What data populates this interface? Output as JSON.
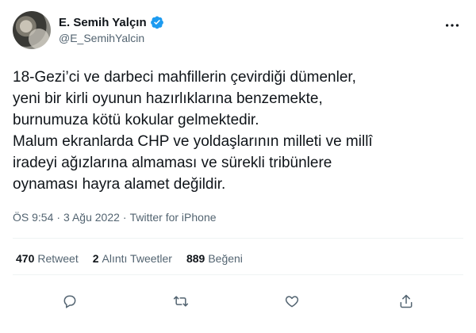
{
  "user": {
    "display_name": "E. Semih Yalçın",
    "handle": "@E_SemihYalcin",
    "verified": true
  },
  "tweet": {
    "text": "18-Gezi’ci ve darbeci mahfillerin çevirdiği dümenler,\nyeni bir kirli oyunun hazırlıklarına benzemekte,\nburnumuza kötü kokular gelmektedir.\nMalum ekranlarda CHP ve yoldaşlarının milleti ve millî\niradeyi ağızlarına almaması ve sürekli tribünlere\noynaması hayra alamet değildir.",
    "time": "ÖS 9:54",
    "separator": "·",
    "date": "3 Ağu 2022",
    "source": "Twitter for iPhone"
  },
  "stats": {
    "retweets_count": "470",
    "retweets_label": "Retweet",
    "quotes_count": "2",
    "quotes_label": "Alıntı Tweetler",
    "likes_count": "889",
    "likes_label": "Beğeni"
  },
  "icons": {
    "more": "more-horizontal-icon",
    "verified": "verified-badge-icon",
    "reply": "reply-bubble-icon",
    "retweet": "retweet-arrows-icon",
    "like": "heart-icon",
    "share": "share-upload-icon"
  },
  "colors": {
    "text": "#0f1419",
    "muted": "#536471",
    "verified": "#1d9bf0",
    "divider": "#eff3f4"
  }
}
